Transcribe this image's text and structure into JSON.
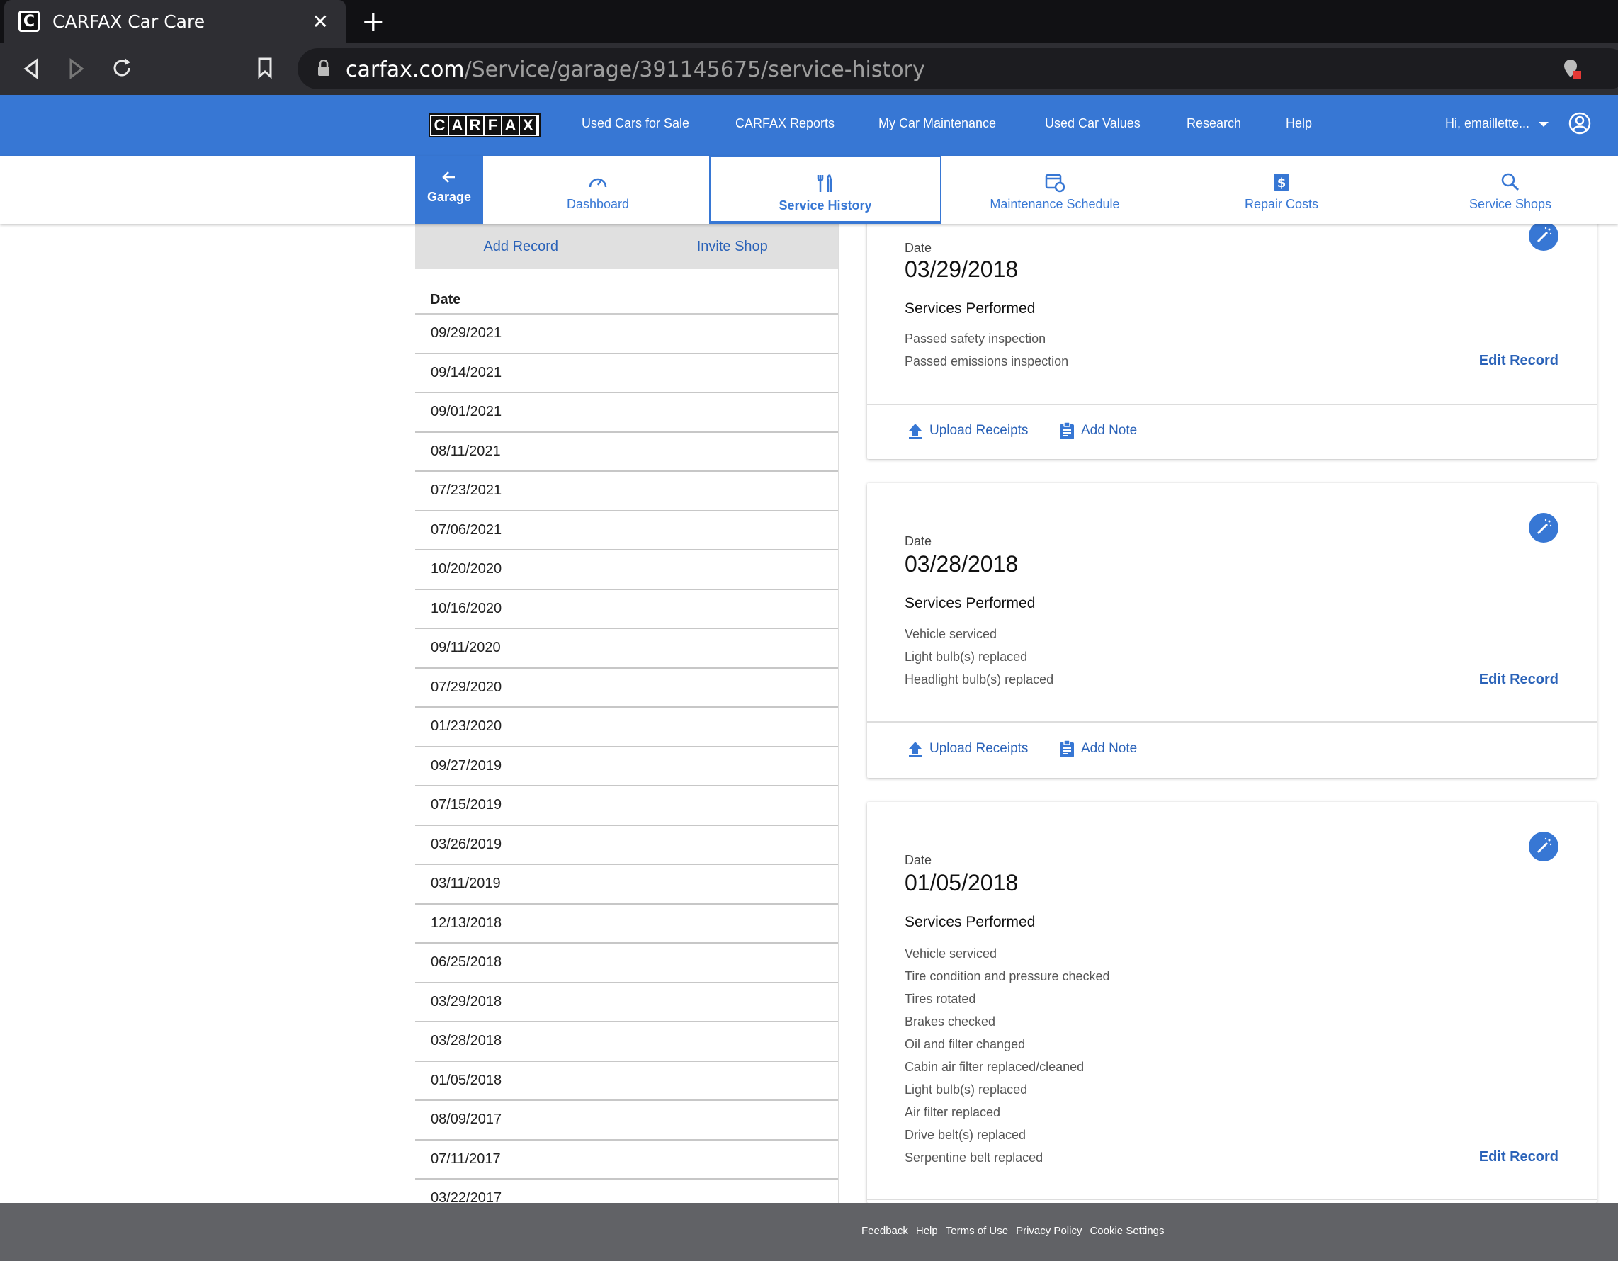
{
  "browser": {
    "tab_title": "CARFAX Car Care",
    "favicon_letter": "C",
    "url_domain": "carfax.com",
    "url_path": "/Service/garage/391145675/service-history"
  },
  "header": {
    "logo_letters": [
      "C",
      "A",
      "R",
      "F",
      "A",
      "X"
    ],
    "nav": [
      "Used Cars for Sale",
      "CARFAX Reports",
      "My Car Maintenance",
      "Used Car Values",
      "Research",
      "Help"
    ],
    "user": "Hi, emaillette..."
  },
  "subnav": {
    "garage": "Garage",
    "tabs": [
      "Dashboard",
      "Service History",
      "Maintenance Schedule",
      "Repair Costs",
      "Service Shops"
    ],
    "active": "Service History"
  },
  "left": {
    "add_record": "Add Record",
    "invite_shop": "Invite Shop",
    "date_header": "Date",
    "dates": [
      "09/29/2021",
      "09/14/2021",
      "09/01/2021",
      "08/11/2021",
      "07/23/2021",
      "07/06/2021",
      "10/20/2020",
      "10/16/2020",
      "09/11/2020",
      "07/29/2020",
      "01/23/2020",
      "09/27/2019",
      "07/15/2019",
      "03/26/2019",
      "03/11/2019",
      "12/13/2018",
      "06/25/2018",
      "03/29/2018",
      "03/28/2018",
      "01/05/2018",
      "08/09/2017",
      "07/11/2017",
      "03/22/2017"
    ]
  },
  "cards": [
    {
      "date_label": "Date",
      "date": "03/29/2018",
      "services_title": "Services Performed",
      "services": [
        "Passed safety inspection",
        "Passed emissions inspection"
      ],
      "edit": "Edit Record",
      "upload": "Upload Receipts",
      "note": "Add Note"
    },
    {
      "date_label": "Date",
      "date": "03/28/2018",
      "services_title": "Services Performed",
      "services": [
        "Vehicle serviced",
        "Light bulb(s) replaced",
        "Headlight bulb(s) replaced"
      ],
      "edit": "Edit Record",
      "upload": "Upload Receipts",
      "note": "Add Note"
    },
    {
      "date_label": "Date",
      "date": "01/05/2018",
      "services_title": "Services Performed",
      "services": [
        "Vehicle serviced",
        "Tire condition and pressure checked",
        "Tires rotated",
        "Brakes checked",
        "Oil and filter changed",
        "Cabin air filter replaced/cleaned",
        "Light bulb(s) replaced",
        "Air filter replaced",
        "Drive belt(s) replaced",
        "Serpentine belt replaced"
      ],
      "edit": "Edit Record"
    }
  ],
  "footer": [
    "Feedback",
    "Help",
    "Terms of Use",
    "Privacy Policy",
    "Cookie Settings"
  ],
  "colors": {
    "brand_blue": "#3777d4",
    "link_blue": "#2a62b8",
    "footer_gray": "#616266"
  }
}
